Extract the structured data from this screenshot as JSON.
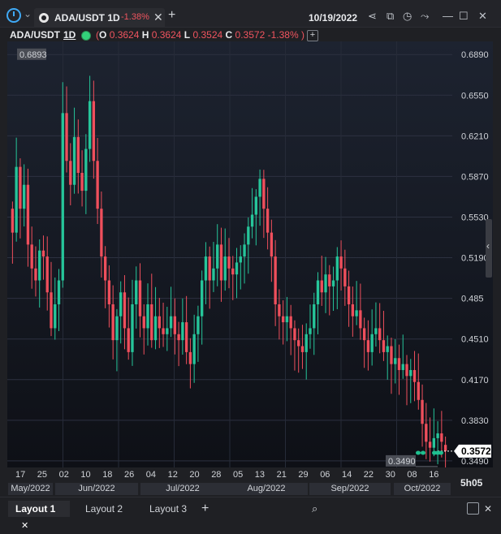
{
  "window": {
    "tab_title": "ADA/USDT 1D",
    "tab_change": "-1.38%",
    "date": "10/19/2022",
    "new_tab": "+",
    "close_tab": "✕"
  },
  "header": {
    "symbol": "ADA/USDT",
    "timeframe": "1D",
    "ohlc": {
      "open_label": "O",
      "open": "0.3624",
      "high_label": "H",
      "high": "0.3624",
      "low_label": "L",
      "low": "0.3524",
      "close_label": "C",
      "close": "0.3572",
      "change": "-1.38%",
      "lparen": "(",
      "rparen": ")"
    },
    "add_indicator": "+"
  },
  "colors": {
    "up": "#26c59a",
    "down": "#ef4f5c",
    "accent": "#3fa9f5",
    "background": "#131722"
  },
  "chart_data": {
    "type": "candlestick",
    "symbol": "ADA/USDT",
    "interval": "1D",
    "y_ticks": [
      0.689,
      0.655,
      0.621,
      0.587,
      0.553,
      0.519,
      0.485,
      0.451,
      0.417,
      0.383,
      0.349
    ],
    "y_tick_labels": [
      "0.6890",
      "0.6550",
      "0.6210",
      "0.5870",
      "0.5530",
      "0.5190",
      "0.485",
      "0.4510",
      "0.4170",
      "0.3830",
      "0.3490"
    ],
    "ylim": [
      0.3435,
      0.7
    ],
    "last_price": "0.3572",
    "max_label": "0.6893",
    "min_label": "0.3490",
    "x_tick_labels": [
      "17",
      "25",
      "02",
      "10",
      "18",
      "26",
      "04",
      "12",
      "20",
      "28",
      "05",
      "13",
      "21",
      "29",
      "06",
      "14",
      "22",
      "30",
      "08",
      "16"
    ],
    "month_labels": [
      "May/2022",
      "Jun/2022",
      "Jul/2022",
      "Aug/2022",
      "Sep/2022",
      "Oct/2022"
    ],
    "closes": [
      0.54,
      0.595,
      0.56,
      0.58,
      0.53,
      0.51,
      0.5,
      0.525,
      0.52,
      0.49,
      0.46,
      0.48,
      0.5,
      0.64,
      0.6,
      0.58,
      0.62,
      0.59,
      0.575,
      0.61,
      0.65,
      0.6,
      0.56,
      0.52,
      0.5,
      0.48,
      0.45,
      0.47,
      0.49,
      0.46,
      0.44,
      0.48,
      0.5,
      0.47,
      0.46,
      0.48,
      0.45,
      0.47,
      0.46,
      0.455,
      0.46,
      0.47,
      0.455,
      0.45,
      0.465,
      0.44,
      0.43,
      0.455,
      0.47,
      0.5,
      0.52,
      0.5,
      0.51,
      0.53,
      0.5,
      0.52,
      0.51,
      0.505,
      0.515,
      0.52,
      0.53,
      0.545,
      0.555,
      0.57,
      0.585,
      0.56,
      0.54,
      0.52,
      0.48,
      0.47,
      0.465,
      0.47,
      0.46,
      0.45,
      0.445,
      0.44,
      0.455,
      0.46,
      0.48,
      0.5,
      0.49,
      0.505,
      0.495,
      0.5,
      0.52,
      0.51,
      0.495,
      0.48,
      0.47,
      0.475,
      0.46,
      0.45,
      0.44,
      0.455,
      0.46,
      0.45,
      0.44,
      0.445,
      0.43,
      0.435,
      0.425,
      0.43,
      0.42,
      0.425,
      0.415,
      0.4,
      0.38,
      0.365,
      0.36,
      0.368,
      0.372,
      0.365,
      0.3572
    ],
    "opens": [
      0.56,
      0.54,
      0.595,
      0.56,
      0.58,
      0.53,
      0.51,
      0.5,
      0.525,
      0.52,
      0.49,
      0.46,
      0.48,
      0.5,
      0.64,
      0.6,
      0.58,
      0.62,
      0.59,
      0.575,
      0.61,
      0.65,
      0.6,
      0.56,
      0.52,
      0.5,
      0.48,
      0.45,
      0.47,
      0.49,
      0.46,
      0.44,
      0.48,
      0.5,
      0.47,
      0.46,
      0.48,
      0.45,
      0.47,
      0.46,
      0.455,
      0.46,
      0.47,
      0.455,
      0.45,
      0.465,
      0.44,
      0.43,
      0.455,
      0.47,
      0.5,
      0.52,
      0.5,
      0.51,
      0.53,
      0.5,
      0.52,
      0.51,
      0.505,
      0.515,
      0.52,
      0.53,
      0.545,
      0.555,
      0.57,
      0.585,
      0.56,
      0.54,
      0.52,
      0.48,
      0.47,
      0.465,
      0.47,
      0.46,
      0.45,
      0.445,
      0.44,
      0.455,
      0.46,
      0.48,
      0.5,
      0.49,
      0.505,
      0.495,
      0.5,
      0.52,
      0.51,
      0.495,
      0.48,
      0.47,
      0.475,
      0.46,
      0.45,
      0.44,
      0.455,
      0.46,
      0.45,
      0.44,
      0.445,
      0.43,
      0.435,
      0.425,
      0.43,
      0.42,
      0.425,
      0.415,
      0.4,
      0.38,
      0.365,
      0.36,
      0.368,
      0.372,
      0.3624
    ]
  },
  "x_axis": {
    "ticks": [
      "17",
      "25",
      "02",
      "10",
      "18",
      "26",
      "04",
      "12",
      "20",
      "28",
      "05",
      "13",
      "21",
      "29",
      "06",
      "14",
      "22",
      "30",
      "08",
      "16"
    ],
    "months": [
      "May/2022",
      "Jun/2022",
      "Jul/2022",
      "Aug/2022",
      "Sep/2022",
      "Oct/2022"
    ],
    "countdown": "5h05"
  },
  "layouts": {
    "tabs": [
      "Layout 1",
      "Layout 2",
      "Layout 3"
    ],
    "close": "✕",
    "add": "+"
  }
}
